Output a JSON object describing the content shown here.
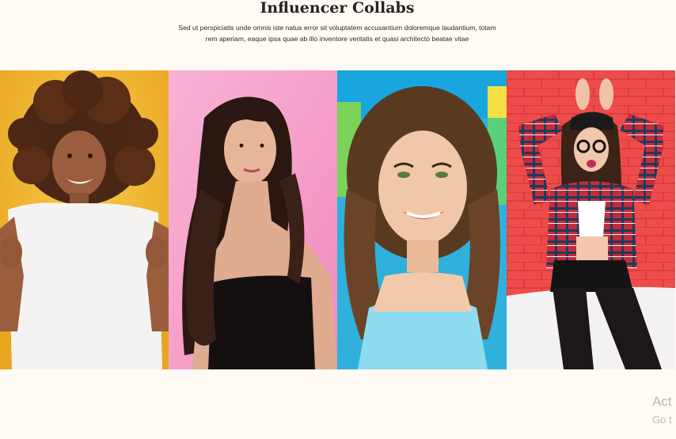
{
  "section": {
    "title": "Influencer Collabs",
    "description_line1": "Sed ut perspiciatis unde omnis iste natus error sit voluptatem accusantium doloremque laudantium, totam",
    "description_line2": "rem aperiam, eaque ipsa quae ab illo inventore veritatis et quasi architecto beatae vitae"
  },
  "gallery": {
    "tiles": [
      {
        "name": "influencer-curly-hair-white-tee",
        "background": "#f1b72e"
      },
      {
        "name": "influencer-long-dark-hair-black-top",
        "background": "#f7a8cf"
      },
      {
        "name": "influencer-wavy-hair-blue-top",
        "background": "#3fb9e4"
      },
      {
        "name": "influencer-plaid-shirt-red-brick-wall",
        "background": "#ee4a4a"
      }
    ]
  },
  "watermark": {
    "line1": "Act",
    "line2": "Go t"
  }
}
